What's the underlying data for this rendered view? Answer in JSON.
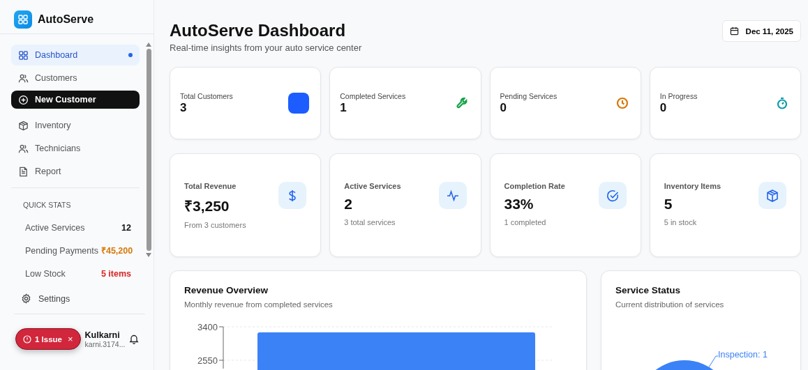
{
  "brand": {
    "name": "AutoServe"
  },
  "nav": [
    {
      "label": "Dashboard",
      "selected": true
    },
    {
      "label": "Customers",
      "selected": false
    },
    {
      "label": "New Customer",
      "kind": "action",
      "selected": false
    },
    {
      "label": "Inventory",
      "selected": false
    },
    {
      "label": "Technicians",
      "selected": false
    },
    {
      "label": "Report",
      "selected": false
    }
  ],
  "quick_stats": {
    "title": "QUICK STATS",
    "items": [
      {
        "label": "Active Services",
        "value": "12",
        "color": "#111111"
      },
      {
        "label": "Pending Payments",
        "value": "₹45,200",
        "color": "#d97706"
      },
      {
        "label": "Low Stock",
        "value": "5 items",
        "color": "#dc2626"
      }
    ]
  },
  "settings": {
    "label": "Settings"
  },
  "user": {
    "name": "Kulkarni",
    "email": "karni.3174..."
  },
  "issue_badge": {
    "label": "1 Issue",
    "close": "×"
  },
  "header": {
    "title": "AutoServe Dashboard",
    "subtitle": "Real-time insights from your auto service center",
    "date": "Dec 11, 2025"
  },
  "summary_cards": [
    {
      "label": "Total Customers",
      "value": "3",
      "color": "#1d5cff"
    },
    {
      "label": "Completed Services",
      "value": "1",
      "color": "#16a34a"
    },
    {
      "label": "Pending Services",
      "value": "0",
      "color": "#d97706"
    },
    {
      "label": "In Progress",
      "value": "0",
      "color": "#0e9ca8"
    }
  ],
  "metric_cards": [
    {
      "label": "Total Revenue",
      "value": "₹3,250",
      "note": "From 3 customers"
    },
    {
      "label": "Active Services",
      "value": "2",
      "note": "3 total services"
    },
    {
      "label": "Completion Rate",
      "value": "33%",
      "note": "1 completed"
    },
    {
      "label": "Inventory Items",
      "value": "5",
      "note": "5 in stock"
    }
  ],
  "revenue": {
    "title": "Revenue Overview",
    "subtitle": "Monthly revenue from completed services",
    "axis_labels": [
      "3400",
      "2550"
    ]
  },
  "status": {
    "title": "Service Status",
    "subtitle": "Current distribution of services",
    "slice_label": "Inspection: 1"
  }
}
